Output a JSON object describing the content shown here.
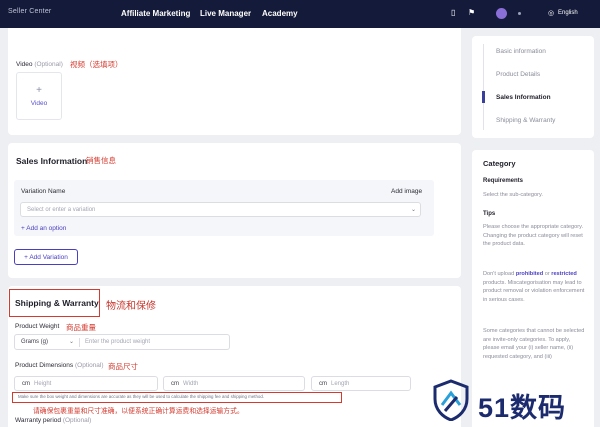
{
  "nav": {
    "logo": "Seller Center",
    "links": [
      "Affiliate Marketing",
      "Live Manager",
      "Academy"
    ],
    "language": "English"
  },
  "video": {
    "label": "Video",
    "optional": "(Optional)",
    "cn_note": "视频（选填项）",
    "upload_text": "Video"
  },
  "sales": {
    "title": "Sales Information",
    "cn_note": "销售信息",
    "variation_name_label": "Variation Name",
    "add_image": "Add image",
    "variation_placeholder": "Select or enter a variation",
    "add_option": "+ Add an option",
    "add_variation": "+ Add Variation"
  },
  "shipping": {
    "title": "Shipping & Warranty",
    "cn_title": "物流和保修",
    "weight_label": "Product Weight",
    "weight_cn": "商品重量",
    "weight_unit": "Grams (g)",
    "weight_placeholder": "Enter the product weight",
    "dims_label": "Product Dimensions",
    "dims_optional": "(Optional)",
    "dims_cn": "商品尺寸",
    "dims": [
      {
        "unit": "cm",
        "placeholder": "Height"
      },
      {
        "unit": "cm",
        "placeholder": "Width"
      },
      {
        "unit": "cm",
        "placeholder": "Length"
      }
    ],
    "dims_note": "Make sure the box weight and dimensions are accurate as they will be used to calculate the shipping fee and shipping method.",
    "dims_note_cn": "请确保包裹重量和尺寸准确，以便系统正确计算运费和选择运输方式。",
    "warranty_label": "Warranty period",
    "warranty_optional": "(Optional)"
  },
  "steps": [
    "Basic information",
    "Product Details",
    "Sales Information",
    "Shipping & Warranty"
  ],
  "category": {
    "title": "Category",
    "requirements_title": "Requirements",
    "requirements_text": "Select the sub-category.",
    "tips_title": "Tips",
    "tip1": "Please choose the appropriate category. Changing the product category will reset the product data.",
    "tip2_pre": "Don't upload",
    "tip2_prohibited": "prohibited",
    "tip2_or": "or",
    "tip2_restricted": "restricted",
    "tip2_post": "products. Miscategorisation may lead to product removal or violation enforcement in serious cases.",
    "tip3": "Some categories that cannot be selected are invite-only categories. To apply, please email your (i) seller name, (ii) requested category, and (iii)"
  },
  "watermark": "51数码",
  "colors": {
    "nav_bg": "#141a3a",
    "accent": "#4a3fc2",
    "annotation_red": "#d43a2f",
    "page_bg": "#eeeff3"
  }
}
